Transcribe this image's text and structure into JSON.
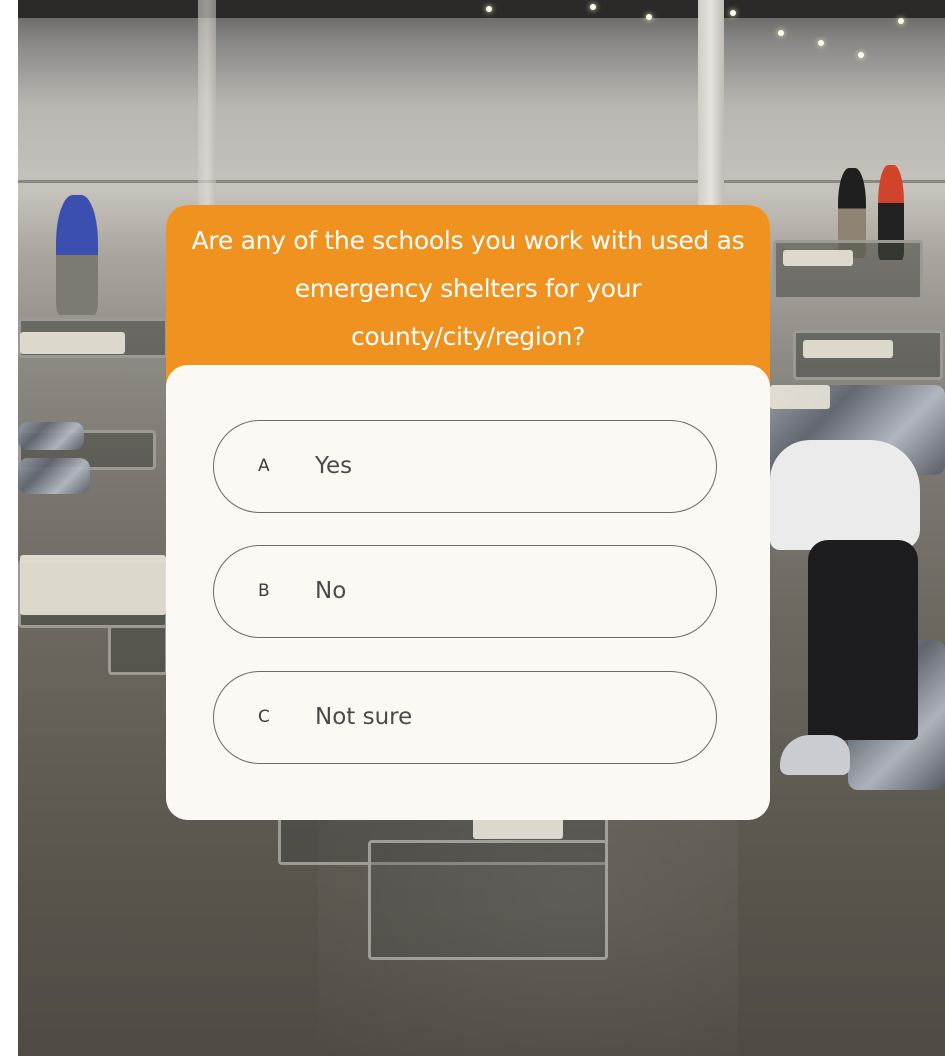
{
  "poll": {
    "question": "Are any of the schools you work with used as emergency shelters for your county/city/region?",
    "options": [
      {
        "key": "A",
        "label": "Yes"
      },
      {
        "key": "B",
        "label": "No"
      },
      {
        "key": "C",
        "label": "Not sure"
      }
    ]
  },
  "colors": {
    "header": "#f0921f",
    "card": "#fcf9f5",
    "option_border": "#6a6a6a",
    "question_text": "#ffffff"
  },
  "background": {
    "icon": "photo-shelter-cots"
  }
}
